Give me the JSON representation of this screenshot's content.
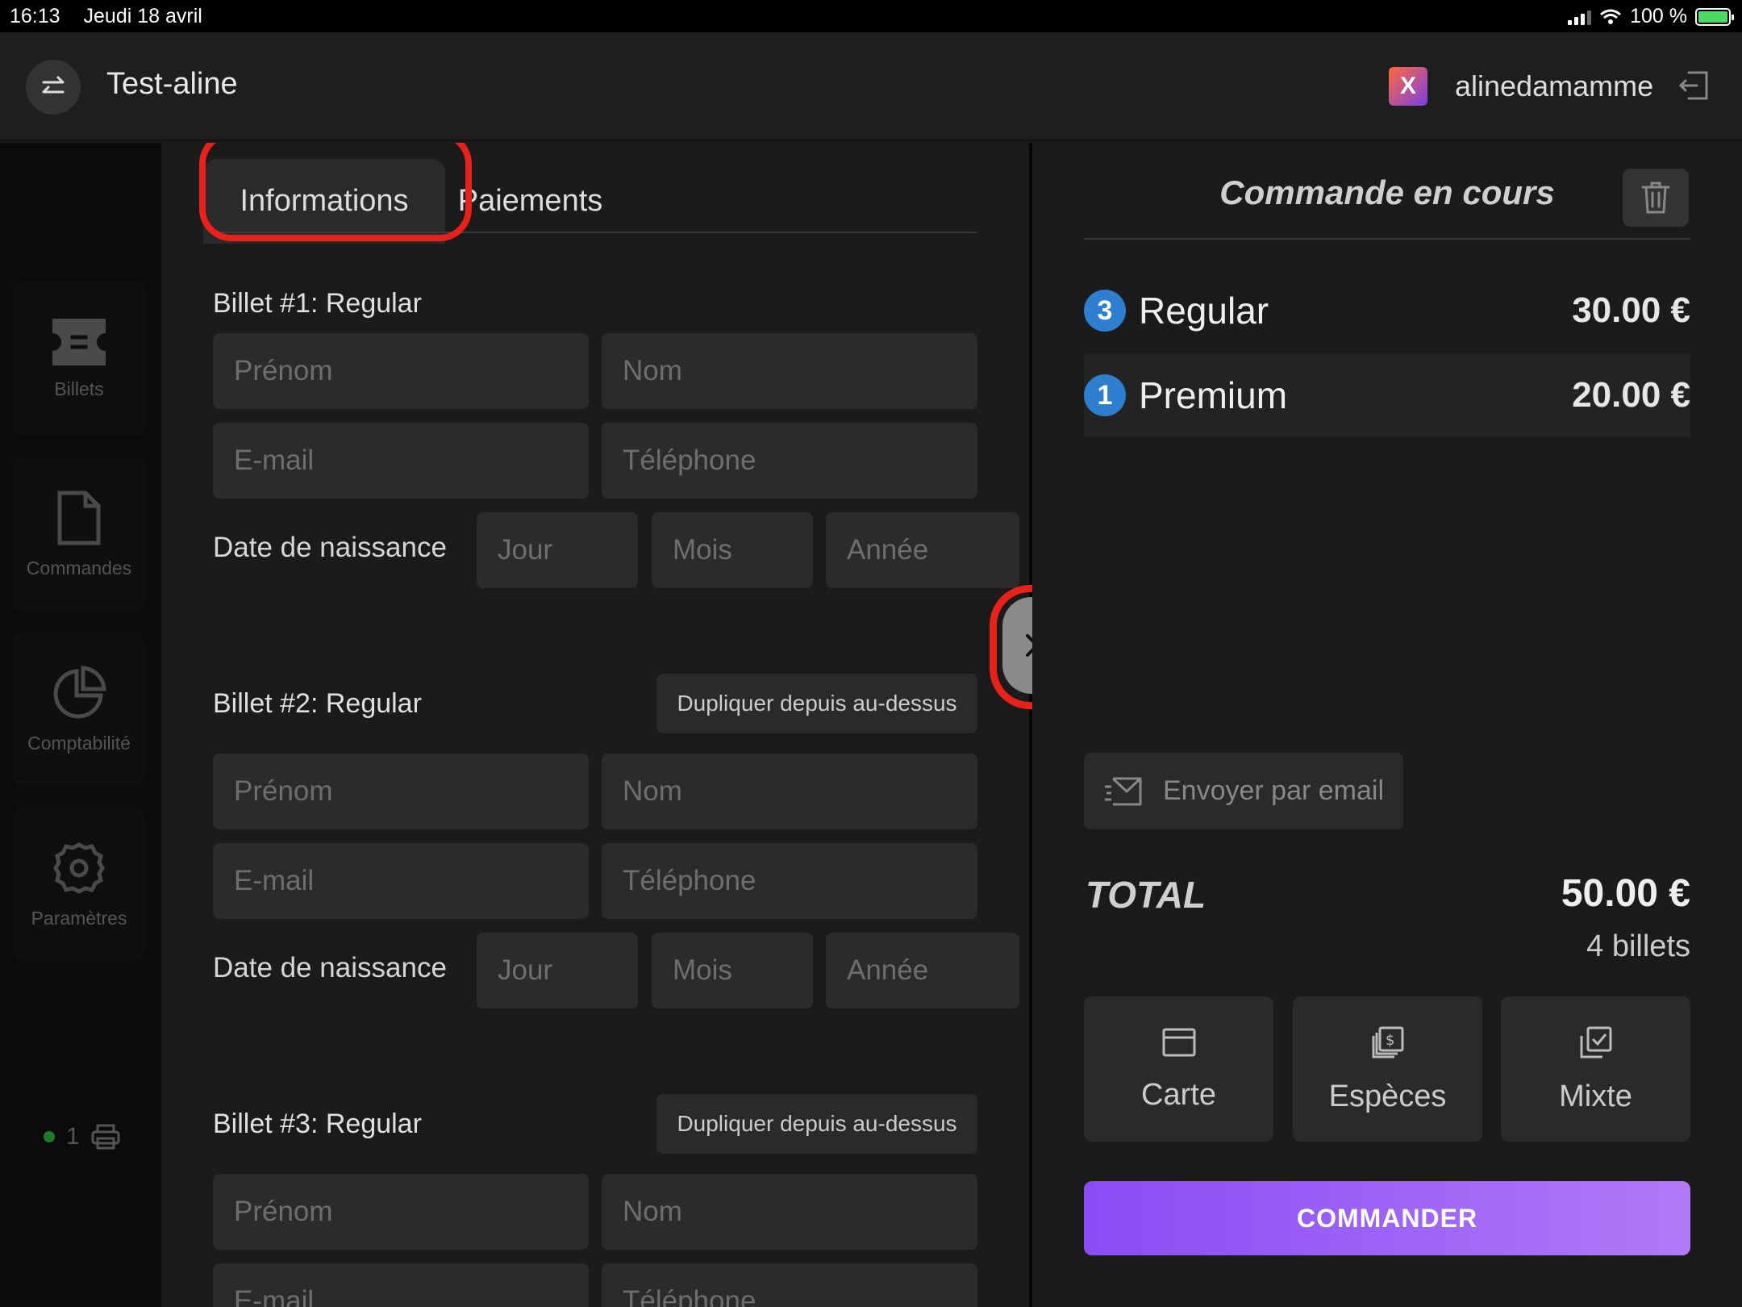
{
  "status_bar": {
    "time": "16:13",
    "date": "Jeudi 18 avril",
    "battery": "100 %"
  },
  "header": {
    "event_title": "Test-aline",
    "username": "alinedamamme",
    "logo_letter": "X"
  },
  "sidebar": {
    "items": [
      {
        "label": "Billets",
        "icon": "ticket-icon"
      },
      {
        "label": "Commandes",
        "icon": "document-icon"
      },
      {
        "label": "Comptabilité",
        "icon": "pie-chart-icon"
      },
      {
        "label": "Paramètres",
        "icon": "gear-icon"
      }
    ],
    "printer_count": "1"
  },
  "tabs": {
    "informations": "Informations",
    "paiements": "Paiements"
  },
  "form": {
    "duplicate_label": "Dupliquer depuis au-dessus",
    "dob_label": "Date de naissance",
    "placeholders": {
      "prenom": "Prénom",
      "nom": "Nom",
      "email": "E-mail",
      "telephone": "Téléphone",
      "jour": "Jour",
      "mois": "Mois",
      "annee": "Année"
    },
    "billets": [
      {
        "title": "Billet #1: Regular"
      },
      {
        "title": "Billet #2: Regular"
      },
      {
        "title": "Billet #3: Regular"
      }
    ]
  },
  "order": {
    "title": "Commande en cours",
    "items": [
      {
        "qty": "3",
        "name": "Regular",
        "price": "30.00 €"
      },
      {
        "qty": "1",
        "name": "Premium",
        "price": "20.00 €"
      }
    ],
    "email_button": "Envoyer par email",
    "total_label": "TOTAL",
    "total_amount": "50.00 €",
    "total_count": "4 billets",
    "payment_methods": {
      "carte": "Carte",
      "especes": "Espèces",
      "mixte": "Mixte"
    },
    "commander": "COMMANDER"
  },
  "colors": {
    "accent": "#9b5cf6",
    "highlight": "#e8211b",
    "badge": "#2f7fd0"
  }
}
